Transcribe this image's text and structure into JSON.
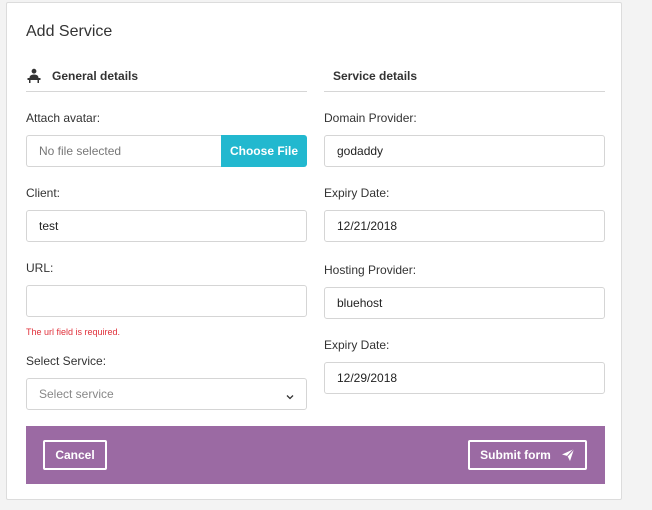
{
  "title": "Add Service",
  "general": {
    "heading": "General details",
    "avatar_label": "Attach avatar:",
    "file_text": "No file selected",
    "file_button": "Choose File",
    "client_label": "Client:",
    "client_value": "test",
    "url_label": "URL:",
    "url_value": "",
    "url_error": "The url field is required.",
    "service_label": "Select Service:",
    "service_placeholder": "Select service"
  },
  "service": {
    "heading": "Service details",
    "domain_label": "Domain Provider:",
    "domain_value": "godaddy",
    "domain_expiry_label": "Expiry Date:",
    "domain_expiry_value": "12/21/2018",
    "hosting_label": "Hosting Provider:",
    "hosting_value": "bluehost",
    "hosting_expiry_label": "Expiry Date:",
    "hosting_expiry_value": "12/29/2018"
  },
  "footer": {
    "cancel": "Cancel",
    "submit": "Submit form"
  },
  "colors": {
    "footer_bg": "#9b6aa3",
    "file_button_bg": "#22b8cf",
    "error": "#e0303a"
  },
  "icons": {
    "general": "person-at-desk-icon",
    "submit": "paper-plane-icon",
    "select": "chevron-down-icon"
  }
}
